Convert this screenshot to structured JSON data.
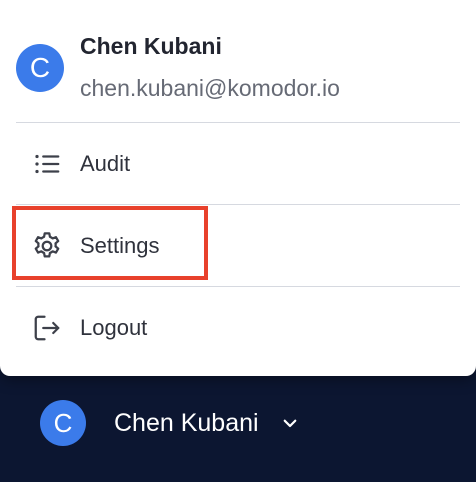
{
  "profile": {
    "avatar_initial": "C",
    "name": "Chen Kubani",
    "email": "chen.kubani@komodor.io"
  },
  "menu": {
    "items": [
      {
        "label": "Audit",
        "icon": "list-icon"
      },
      {
        "label": "Settings",
        "icon": "gear-icon"
      },
      {
        "label": "Logout",
        "icon": "logout-icon"
      }
    ]
  },
  "userbar": {
    "avatar_initial": "C",
    "name": "Chen Kubani",
    "icon": "chevron-down-icon"
  },
  "colors": {
    "background": "#0c1631",
    "avatar": "#3b7bea",
    "highlight": "#e8412c"
  }
}
